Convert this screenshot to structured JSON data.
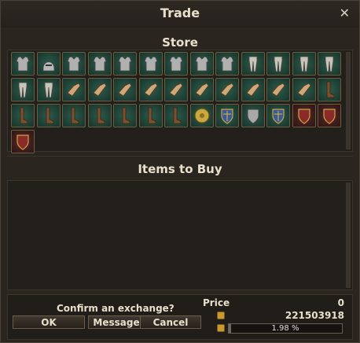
{
  "window": {
    "title": "Trade",
    "close_label": "✕"
  },
  "store": {
    "title": "Store",
    "slots": [
      {
        "kind": "green",
        "icon": "brown-armor-icon"
      },
      {
        "kind": "green",
        "icon": "steel-helmet-icon"
      },
      {
        "kind": "green",
        "icon": "plate-armor-icon"
      },
      {
        "kind": "green",
        "icon": "plate-armor-icon"
      },
      {
        "kind": "green",
        "icon": "plate-armor-icon"
      },
      {
        "kind": "green",
        "icon": "plate-armor-icon"
      },
      {
        "kind": "green",
        "icon": "plate-armor-icon"
      },
      {
        "kind": "green",
        "icon": "gold-armor-icon"
      },
      {
        "kind": "green",
        "icon": "white-tunic-icon"
      },
      {
        "kind": "green",
        "icon": "leg-armor-icon"
      },
      {
        "kind": "green",
        "icon": "leg-armor-icon"
      },
      {
        "kind": "green",
        "icon": "leg-armor-icon"
      },
      {
        "kind": "green",
        "icon": "leg-armor-icon"
      },
      {
        "kind": "green",
        "icon": "leg-armor-icon"
      },
      {
        "kind": "green",
        "icon": "gold-leg-armor-icon"
      },
      {
        "kind": "green",
        "icon": "gauntlet-icon"
      },
      {
        "kind": "green",
        "icon": "gauntlet-icon"
      },
      {
        "kind": "green",
        "icon": "gauntlet-icon"
      },
      {
        "kind": "green",
        "icon": "gauntlet-icon"
      },
      {
        "kind": "green",
        "icon": "gauntlet-icon"
      },
      {
        "kind": "green",
        "icon": "gauntlet-icon"
      },
      {
        "kind": "green",
        "icon": "gauntlet-icon"
      },
      {
        "kind": "green",
        "icon": "gauntlet-icon"
      },
      {
        "kind": "green",
        "icon": "gauntlet-icon"
      },
      {
        "kind": "green",
        "icon": "gauntlet-icon"
      },
      {
        "kind": "green",
        "icon": "boots-icon"
      },
      {
        "kind": "green",
        "icon": "boots-icon"
      },
      {
        "kind": "green",
        "icon": "boots-icon"
      },
      {
        "kind": "green",
        "icon": "boots-icon"
      },
      {
        "kind": "green",
        "icon": "boots-icon"
      },
      {
        "kind": "green",
        "icon": "boots-icon"
      },
      {
        "kind": "green",
        "icon": "boots-icon"
      },
      {
        "kind": "green",
        "icon": "boots-icon"
      },
      {
        "kind": "green",
        "icon": "round-shield-icon"
      },
      {
        "kind": "green",
        "icon": "blue-shield-icon"
      },
      {
        "kind": "green",
        "icon": "heater-shield-icon"
      },
      {
        "kind": "green",
        "icon": "blue-shield-icon"
      },
      {
        "kind": "red",
        "icon": "red-shield-icon"
      },
      {
        "kind": "red",
        "icon": "ornate-shield-icon"
      },
      {
        "kind": "red",
        "icon": "kite-shield-icon"
      }
    ]
  },
  "buy": {
    "title": "Items to Buy"
  },
  "footer": {
    "confirm_text": "Confirm an exchange?",
    "ok_label": "OK",
    "message_label": "Message",
    "cancel_label": "Cancel",
    "price_label": "Price",
    "price_value": "0",
    "gold_value": "221503918",
    "capacity_fraction": 0.0198,
    "capacity_text": "1.98 %"
  },
  "colors": {
    "slot_green": "#173429",
    "slot_red": "#2e1414",
    "frame": "#6b5d40",
    "text": "#e8e0cc"
  }
}
